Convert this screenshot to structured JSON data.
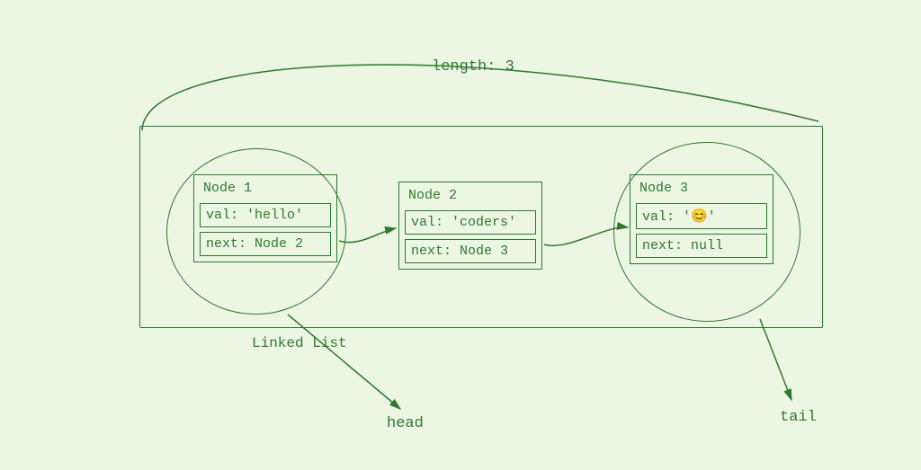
{
  "length_label": "length: 3",
  "caption": "Linked List",
  "nodes": [
    {
      "title": "Node 1",
      "val": "val: 'hello'",
      "next": "next: Node 2"
    },
    {
      "title": "Node 2",
      "val": "val: 'coders'",
      "next": "next: Node 3"
    },
    {
      "title": "Node 3",
      "val": "val: '😊'",
      "next": "next: null"
    }
  ],
  "pointers": {
    "head": "head",
    "tail": "tail"
  }
}
